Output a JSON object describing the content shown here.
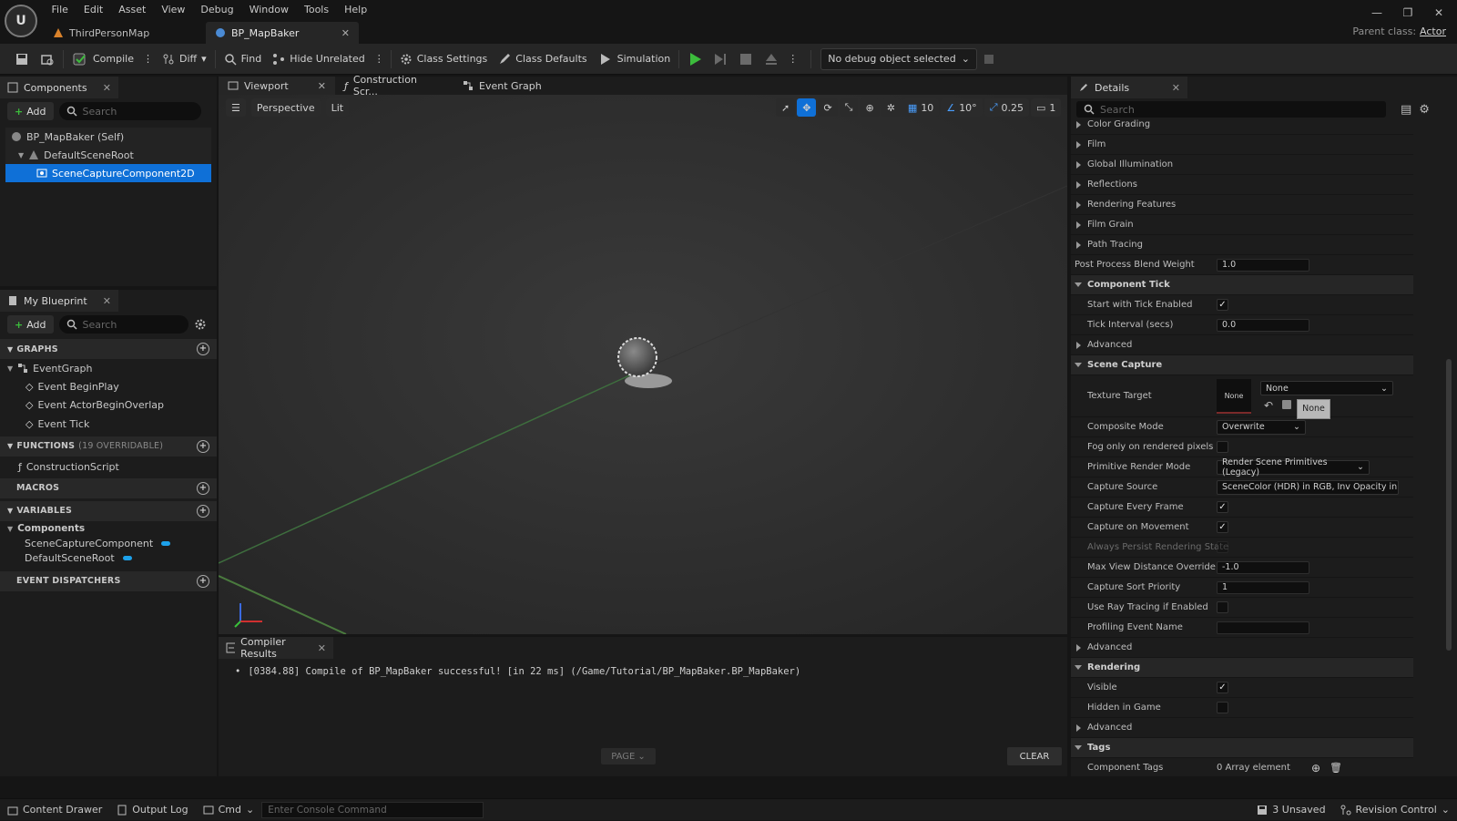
{
  "app": {
    "logo": "U",
    "menu": [
      "File",
      "Edit",
      "Asset",
      "View",
      "Debug",
      "Window",
      "Tools",
      "Help"
    ],
    "doc_tabs": [
      {
        "label": "ThirdPersonMap",
        "active": false
      },
      {
        "label": "BP_MapBaker",
        "active": true
      }
    ],
    "parent_class_label": "Parent class:",
    "parent_class_value": "Actor"
  },
  "toolbar": {
    "compile": "Compile",
    "diff": "Diff",
    "find": "Find",
    "hide_unrelated": "Hide Unrelated",
    "class_settings": "Class Settings",
    "class_defaults": "Class Defaults",
    "simulation": "Simulation",
    "debug_object": "No debug object selected"
  },
  "components_panel": {
    "title": "Components",
    "add": "Add",
    "search_placeholder": "Search",
    "items": [
      {
        "label": "BP_MapBaker (Self)",
        "indent": 0,
        "selected": false
      },
      {
        "label": "DefaultSceneRoot",
        "indent": 1,
        "selected": false
      },
      {
        "label": "SceneCaptureComponent2D",
        "indent": 2,
        "selected": true
      }
    ]
  },
  "my_blueprint": {
    "title": "My Blueprint",
    "add": "Add",
    "search_placeholder": "Search",
    "graphs_header": "GRAPHS",
    "event_graph": "EventGraph",
    "events": [
      "Event BeginPlay",
      "Event ActorBeginOverlap",
      "Event Tick"
    ],
    "functions_header": "FUNCTIONS",
    "functions_note": "(19 OVERRIDABLE)",
    "functions": [
      "ConstructionScript"
    ],
    "macros_header": "MACROS",
    "variables_header": "VARIABLES",
    "variables_group": "Components",
    "variables": [
      "SceneCaptureComponent",
      "DefaultSceneRoot"
    ],
    "dispatchers_header": "EVENT DISPATCHERS"
  },
  "editor_tabs": [
    "Viewport",
    "Construction Scr...",
    "Event Graph"
  ],
  "viewport": {
    "perspective": "Perspective",
    "lit": "Lit",
    "grid_snap": "10",
    "rot_snap": "10°",
    "scale_snap": "0.25",
    "camera_speed": "1"
  },
  "compiler": {
    "title": "Compiler Results",
    "message": "[0384.88] Compile of BP_MapBaker successful! [in 22 ms] (/Game/Tutorial/BP_MapBaker.BP_MapBaker)",
    "page": "PAGE",
    "clear": "CLEAR"
  },
  "details": {
    "title": "Details",
    "search_placeholder": "Search",
    "rows": {
      "color_grading": "Color Grading",
      "film": "Film",
      "global_illumination": "Global Illumination",
      "reflections": "Reflections",
      "rendering_features": "Rendering Features",
      "film_grain": "Film Grain",
      "path_tracing": "Path Tracing",
      "post_process_blend_weight": "Post Process Blend Weight",
      "post_process_blend_weight_val": "1.0",
      "component_tick": "Component Tick",
      "start_with_tick": "Start with Tick Enabled",
      "tick_interval": "Tick Interval (secs)",
      "tick_interval_val": "0.0",
      "advanced": "Advanced",
      "scene_capture": "Scene Capture",
      "texture_target": "Texture Target",
      "texture_thumb": "None",
      "texture_combo": "None",
      "texture_tooltip": "None",
      "composite_mode": "Composite Mode",
      "composite_mode_val": "Overwrite",
      "fog_only": "Fog only on rendered pixels",
      "primitive_render_mode": "Primitive Render Mode",
      "primitive_render_mode_val": "Render Scene Primitives (Legacy)",
      "capture_source": "Capture Source",
      "capture_source_val": "SceneColor (HDR) in RGB, Inv Opacity in",
      "capture_every_frame": "Capture Every Frame",
      "capture_on_movement": "Capture on Movement",
      "always_persist": "Always Persist Rendering State",
      "max_view_distance": "Max View Distance Override",
      "max_view_distance_val": "-1.0",
      "capture_sort_priority": "Capture Sort Priority",
      "capture_sort_priority_val": "1",
      "use_ray_tracing": "Use Ray Tracing if Enabled",
      "profiling_event_name": "Profiling Event Name",
      "rendering": "Rendering",
      "visible": "Visible",
      "hidden_in_game": "Hidden in Game",
      "tags": "Tags",
      "component_tags": "Component Tags",
      "component_tags_val": "0 Array element"
    }
  },
  "statusbar": {
    "content_drawer": "Content Drawer",
    "output_log": "Output Log",
    "cmd": "Cmd",
    "console_placeholder": "Enter Console Command",
    "unsaved": "3 Unsaved",
    "revision_control": "Revision Control"
  },
  "colors": {
    "accent": "#0f70d7",
    "play": "#3cbc3c",
    "background": "#151515"
  }
}
